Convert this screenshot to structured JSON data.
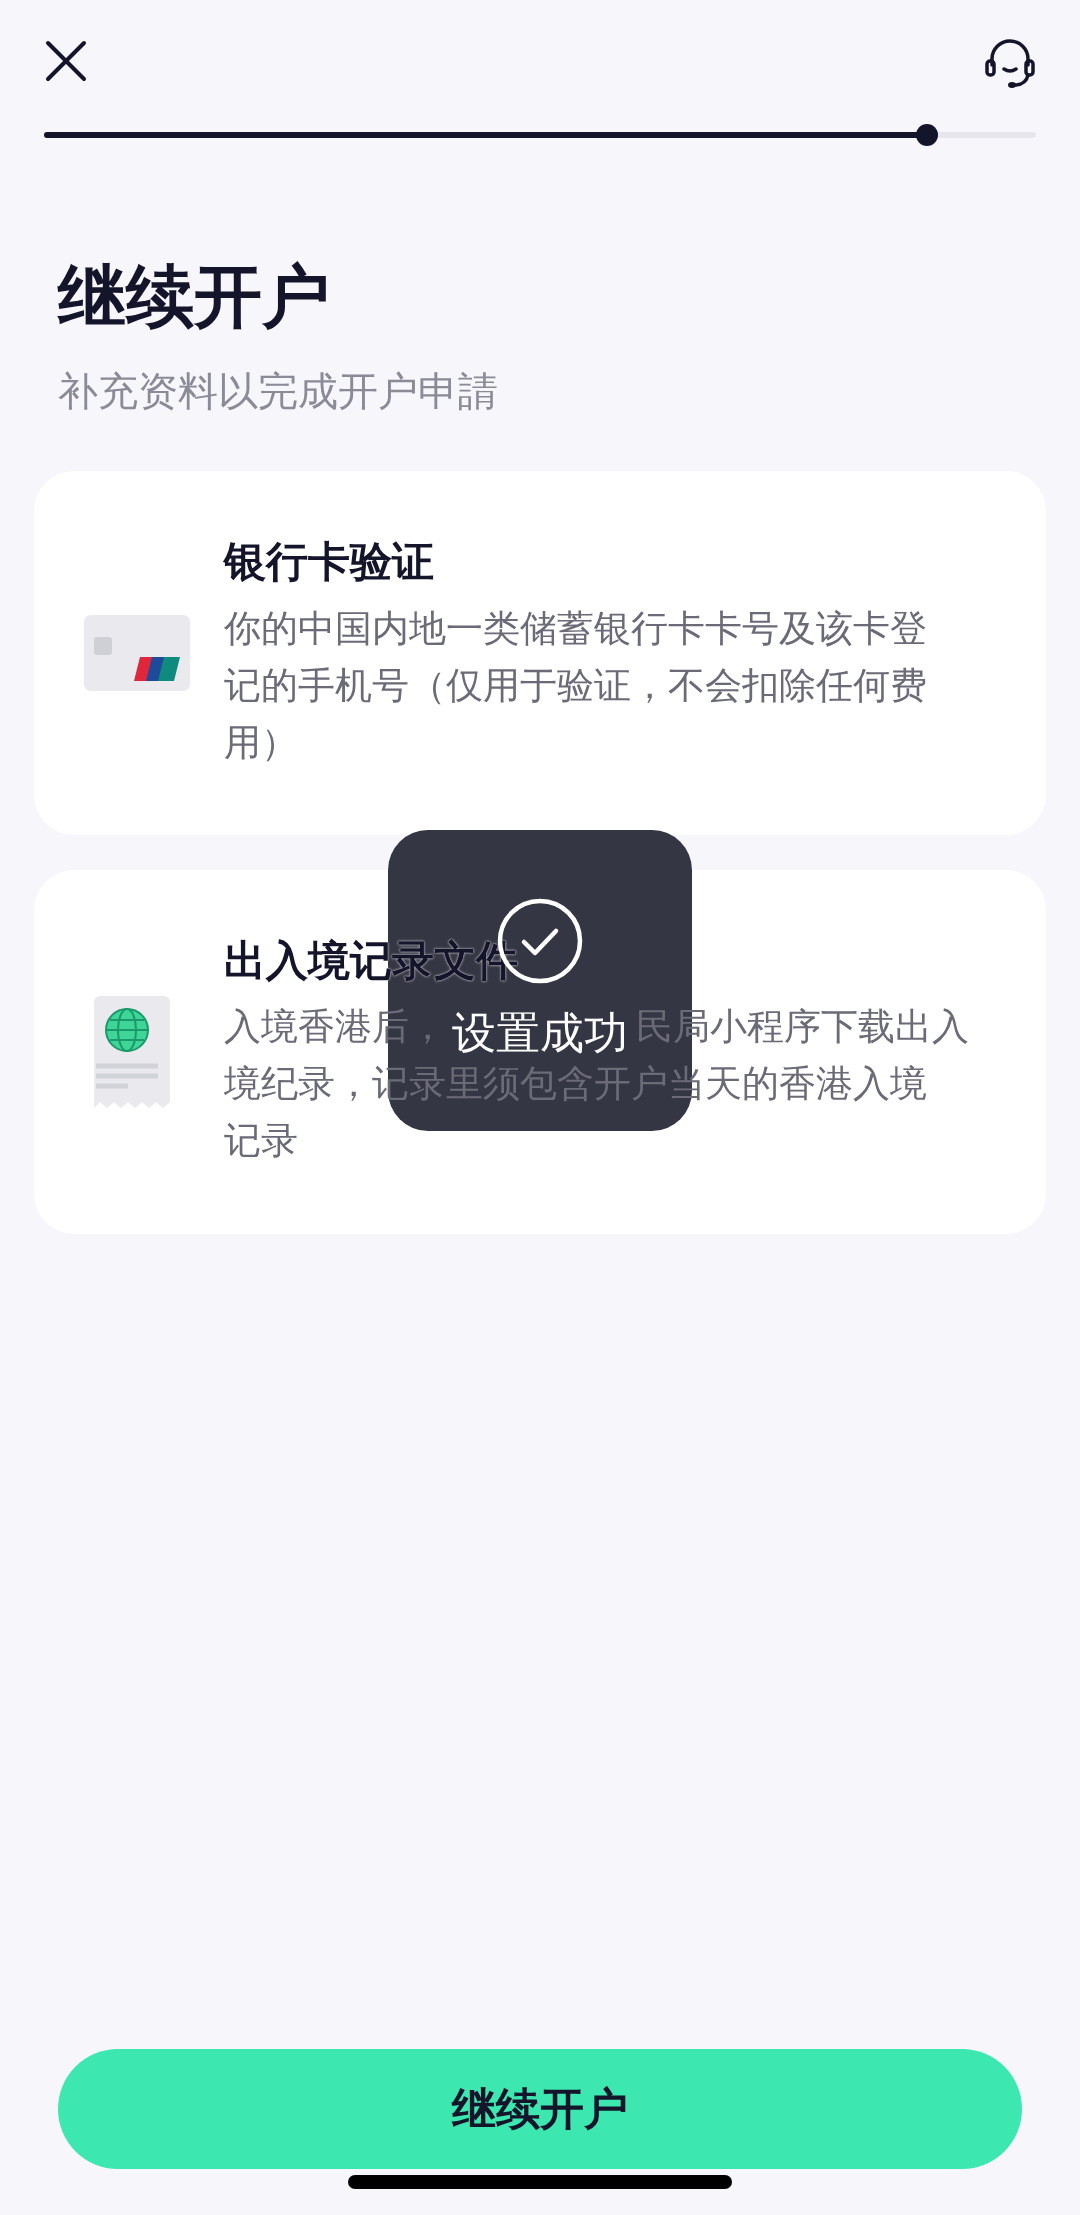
{
  "header": {
    "progress": {
      "level": 0.89
    }
  },
  "title": "继续开户",
  "subtitle": "补充资料以完成开户申請",
  "items": [
    {
      "kind": "bank_card",
      "title": "银行卡验证",
      "description": "你的中国内地一类储蓄银行卡卡号及该卡登记的手机号（仅用于验证，不会扣除任何费用）"
    },
    {
      "kind": "document",
      "title": "出入境记录文件",
      "description_lines": [
        [
          "入境香港后，",
          "民局小程序下载出入"
        ],
        [
          "境纪录，记录里须包含开户当天的香港入境"
        ],
        [
          "记录"
        ]
      ]
    }
  ],
  "toast": {
    "message": "设置成功"
  },
  "primary_button": "继续开户"
}
